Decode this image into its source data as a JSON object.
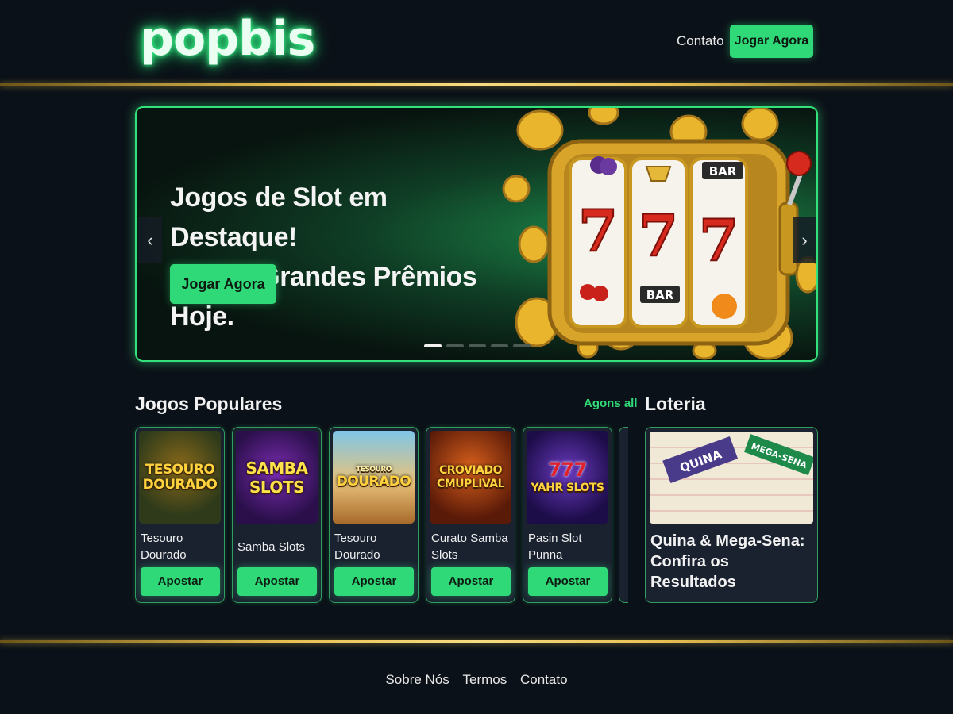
{
  "header": {
    "logo": "popbis",
    "nav_contact": "Contato",
    "cta": "Jogar Agora"
  },
  "hero": {
    "title_line1": "Jogos de Slot em Destaque!",
    "title_line2": "Ganhe Grandes Prêmios Hoje.",
    "cta": "Jogar Agora",
    "prev_icon": "chevron-left-icon",
    "next_icon": "chevron-right-icon",
    "slides_total": 5,
    "slide_active": 1,
    "slot_symbols": [
      "7",
      "7",
      "7"
    ],
    "slot_labels": [
      "BAR",
      "BAR"
    ]
  },
  "popular": {
    "title": "Jogos Populares",
    "see_all": "Agons all",
    "games": [
      {
        "thumb_text": "TESOURO DOURADO",
        "name": "Tesouro Dourado",
        "button": "Apostar"
      },
      {
        "thumb_text": "SAMBA SLOTS",
        "name": "Samba Slots",
        "button": "Apostar"
      },
      {
        "thumb_text": "DOURADO",
        "thumb_sub": "TESOURO",
        "name": "Tesouro Dourado",
        "button": "Apostar"
      },
      {
        "thumb_text": "CROVIADO CMUPLIVAL",
        "name": "Curato Samba Slots",
        "button": "Apostar"
      },
      {
        "thumb_text": "YAHR SLOTS",
        "thumb_sub": "777",
        "name": "Pasin Slot Punna",
        "button": "Apostar"
      }
    ]
  },
  "lottery": {
    "title": "Loteria",
    "ticket1": "QUINA",
    "ticket2": "MEGA-SENA",
    "headline": "Quina & Mega-Sena: Confira os Resultados"
  },
  "footer": {
    "links": [
      "Sobre Nós",
      "Termos",
      "Contato"
    ]
  },
  "colors": {
    "accent_green": "#2fd977",
    "gold_line": "#e6bf52",
    "background": "#0b1118"
  }
}
